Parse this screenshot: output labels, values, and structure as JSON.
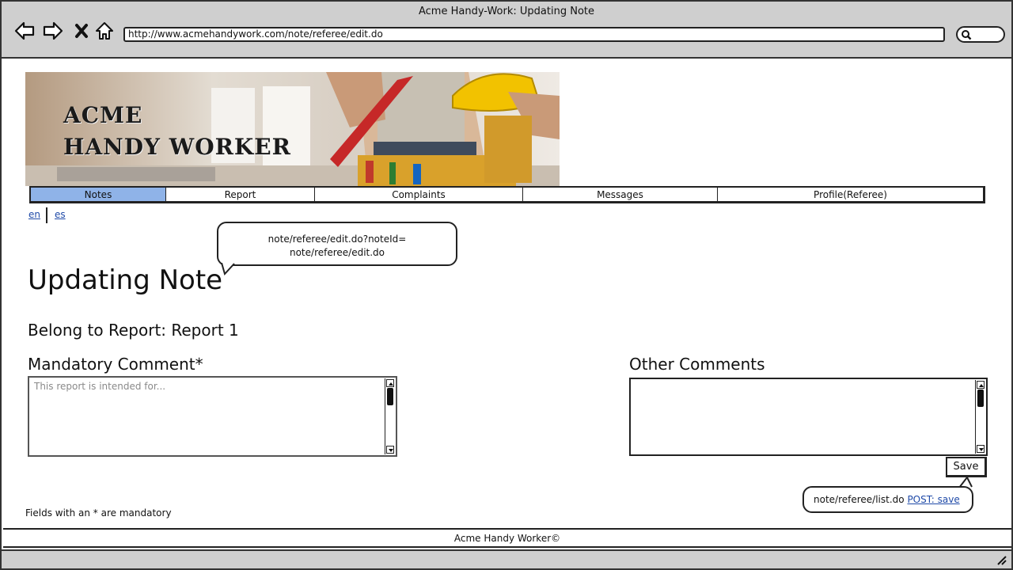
{
  "window": {
    "title": "Acme Handy-Work: Updating Note",
    "url": "http://www.acmehandywork.com/note/referee/edit.do"
  },
  "banner": {
    "line1": "ACME",
    "line2": "HANDY WORKER"
  },
  "tabs": [
    {
      "label": "Notes",
      "active": true
    },
    {
      "label": "Report",
      "active": false
    },
    {
      "label": "Complaints",
      "active": false
    },
    {
      "label": "Messages",
      "active": false
    },
    {
      "label": "Profile(Referee)",
      "active": false
    }
  ],
  "languages": [
    "en",
    "es"
  ],
  "callout_top": {
    "line1": "note/referee/edit.do?noteId=",
    "line2": "note/referee/edit.do"
  },
  "page": {
    "title": "Updating Note",
    "belong_to": "Belong to Report: Report 1"
  },
  "form": {
    "mandatory_label": "Mandatory Comment*",
    "mandatory_placeholder": "This report is intended for...",
    "other_label": "Other Comments",
    "other_value": "",
    "save_label": "Save"
  },
  "callout_save": {
    "text": "note/referee/list.do ",
    "link": "POST: save"
  },
  "mandatory_note": "Fields with an * are mandatory",
  "footer": "Acme Handy Worker©"
}
